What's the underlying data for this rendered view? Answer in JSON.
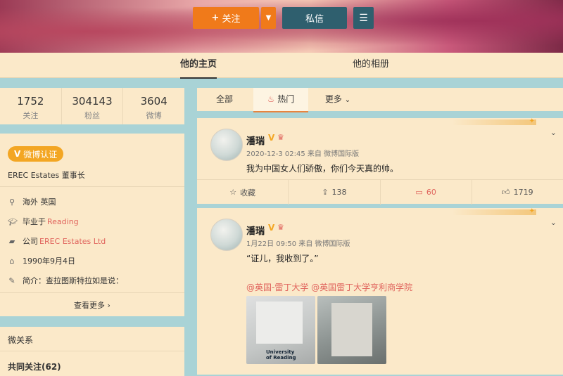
{
  "header": {
    "follow_label": "关注",
    "follow_plus": "+",
    "message_label": "私信"
  },
  "tabs": {
    "home": "他的主页",
    "album": "他的相册"
  },
  "stats": [
    {
      "value": "1752",
      "label": "关注"
    },
    {
      "value": "304143",
      "label": "粉丝"
    },
    {
      "value": "3604",
      "label": "微博"
    }
  ],
  "info": {
    "verified_label": "微博认证",
    "verified_v": "V",
    "verification_text": "EREC Estates 董事长",
    "location": "海外 英国",
    "education_prefix": "毕业于",
    "education_link": "Reading",
    "company_prefix": "公司",
    "company_link": "EREC Estates Ltd",
    "birthday": "1990年9月4日",
    "intro": "简介：查拉图斯特拉如是说：",
    "more": "查看更多"
  },
  "relations": {
    "title": "微关系",
    "common_follow": "共同关注(62)"
  },
  "feed_tabs": {
    "all": "全部",
    "hot": "热门",
    "more": "更多"
  },
  "posts": [
    {
      "name": "潘瑞",
      "meta": "2020-12-3 02:45 来自 微博国际版",
      "text": "我为中国女人们骄傲，你们今天真的帅。",
      "actions": {
        "fav": "收藏",
        "repost": "138",
        "comment": "60",
        "like": "1719"
      }
    },
    {
      "name": "潘瑞",
      "meta": "1月22日 09:50 来自 微博国际版",
      "text": "“证儿，我收到了。”",
      "mentions": "@英国-雷丁大学 @英国雷丁大学亨利商学院",
      "photo1_label": "University of Reading"
    }
  ],
  "colors": {
    "accent": "#f07a1a",
    "dark": "#2f5f6e",
    "card": "#fbe9c9",
    "bg": "#a9d3d6",
    "link": "#e0635c",
    "badge": "#f3a623"
  }
}
